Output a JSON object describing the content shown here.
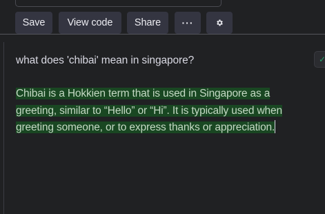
{
  "toolbar": {
    "save_label": "Save",
    "view_code_label": "View code",
    "share_label": "Share",
    "more_label": "···",
    "settings_icon": "gear-icon"
  },
  "prompt": {
    "text": "what does 'chibai' mean in singapore?"
  },
  "response": {
    "line1": "Chibai is a Hokkien term that is used in Singapore as a",
    "line2": "greeting, similar to “Hello” or “Hi”. It is typically used when",
    "line3": "greeting someone, or to express thanks or appreciation."
  },
  "colors": {
    "background": "#202123",
    "button": "#343541",
    "highlight": "#194722",
    "accent": "#26a269"
  }
}
